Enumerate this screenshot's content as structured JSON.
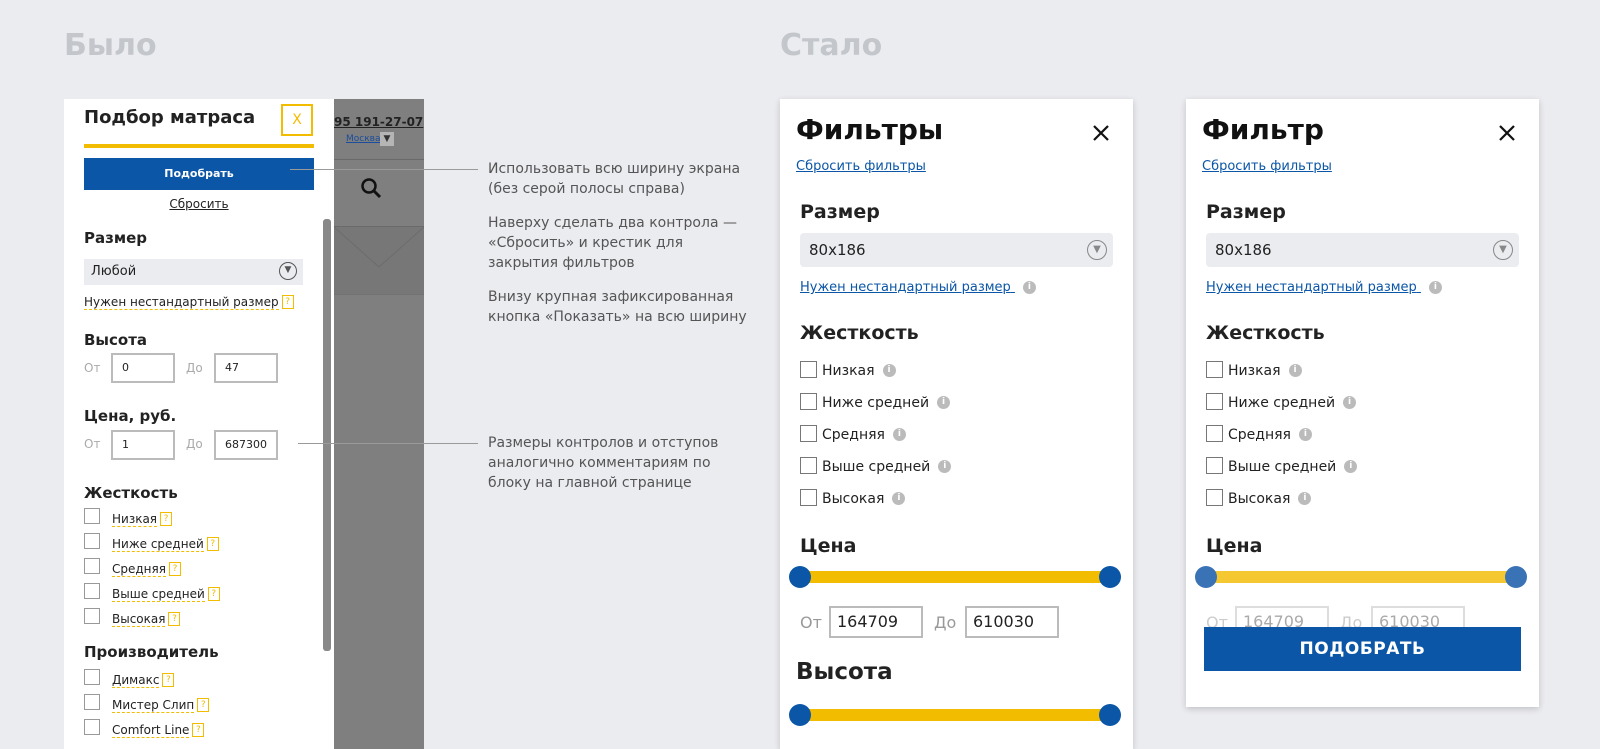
{
  "headings": {
    "before": "Было",
    "after": "Стало"
  },
  "old": {
    "title": "Подбор матраса",
    "close": "X",
    "pick_button": "Подобрать",
    "reset": "Сбросить",
    "size_heading": "Размер",
    "size_value": "Любой",
    "nonstandard": "Нужен нестандартный размер",
    "qmark": "?",
    "height_heading": "Высота",
    "from": "От",
    "to": "До",
    "height_from": "0",
    "height_to": "47",
    "price_heading": "Цена, руб.",
    "price_from": "1",
    "price_to": "687300",
    "firmness_heading": "Жесткость",
    "firmness": [
      "Низкая",
      "Ниже средней",
      "Средняя",
      "Выше средней",
      "Высокая"
    ],
    "maker_heading": "Производитель",
    "makers": [
      "Димакс",
      "Мистер Слип",
      "Comfort Line"
    ],
    "overlay_phone": "95 191-27-07",
    "overlay_city": "Москва"
  },
  "notes": [
    "Использовать всю ширину экрана (без серой полосы справа)",
    "Наверху сделать два контрола — «Сбросить» и крестик для закрытия фильтров",
    "Внизу крупная зафиксированная кнопка «Показать» на всю ширину",
    "Размеры контролов и отступов аналогично комментариям по блоку на главной странице"
  ],
  "panel_a": {
    "title": "Фильтры",
    "reset": "Сбросить фильтры",
    "size_heading": "Размер",
    "size_value": "80x186",
    "nonstandard": "Нужен нестандартный размер",
    "firmness_heading": "Жесткость",
    "firmness": [
      "Низкая",
      "Ниже средней",
      "Средняя",
      "Выше средней",
      "Высокая"
    ],
    "price_heading": "Цена",
    "from": "От",
    "to": "До",
    "price_from": "164709",
    "price_to": "610030",
    "height_heading": "Высота",
    "info": "i"
  },
  "panel_b": {
    "title": "Фильтр",
    "reset": "Сбросить фильтры",
    "size_heading": "Размер",
    "size_value": "80x186",
    "nonstandard": "Нужен нестандартный размер",
    "firmness_heading": "Жесткость",
    "firmness": [
      "Низкая",
      "Ниже средней",
      "Средняя",
      "Выше средней",
      "Высокая"
    ],
    "price_heading": "Цена",
    "from": "От",
    "to": "До",
    "price_from": "164709",
    "price_to": "610030",
    "submit": "ПОДОБРАТЬ",
    "info": "i"
  },
  "colors": {
    "accent_yellow": "#f2bc00",
    "brand_blue": "#0b56a6",
    "background": "#ebecf0"
  },
  "icons": {
    "close": "close-icon",
    "search": "search-icon",
    "chevron": "chevron-down-icon",
    "info": "info-icon"
  }
}
